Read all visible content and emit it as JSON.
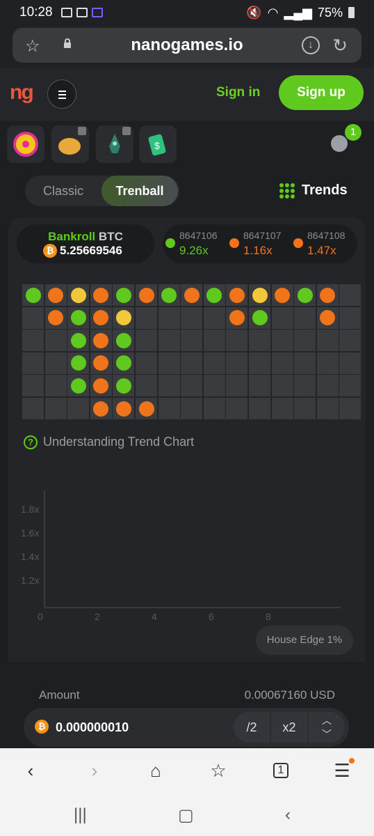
{
  "status": {
    "time": "10:28",
    "battery": "75%"
  },
  "browser": {
    "url": "nanogames.io",
    "tab_count": "1"
  },
  "header": {
    "logo": "ng",
    "signin_label": "Sign in",
    "signup_label": "Sign up"
  },
  "games_strip": {
    "chat_badge": "1"
  },
  "modes": {
    "classic_label": "Classic",
    "trenball_label": "Trenball",
    "active": "Trenball"
  },
  "trends_label": "Trends",
  "bankroll": {
    "label_green": "Bankroll",
    "label_currency": "BTC",
    "value": "5.25669546",
    "icon": "₿"
  },
  "history": [
    {
      "id": "8647106",
      "multiplier": "9.26x",
      "color": "#5fc91e"
    },
    {
      "id": "8647107",
      "multiplier": "1.16x",
      "color": "#f2741a"
    },
    {
      "id": "8647108",
      "multiplier": "1.47x",
      "color": "#f2741a"
    }
  ],
  "trend_grid": {
    "colors": {
      "g": "#5fc91e",
      "o": "#f2741a",
      "y": "#f2c83a"
    },
    "columns": [
      [
        "g",
        "",
        "",
        "",
        "",
        ""
      ],
      [
        "o",
        "o",
        "",
        "",
        "",
        ""
      ],
      [
        "y",
        "g",
        "g",
        "g",
        "g",
        ""
      ],
      [
        "o",
        "o",
        "o",
        "o",
        "o",
        "o"
      ],
      [
        "g",
        "y",
        "g",
        "g",
        "g",
        "o"
      ],
      [
        "o",
        "",
        "",
        "",
        "",
        "o"
      ],
      [
        "g",
        "",
        "",
        "",
        "",
        ""
      ],
      [
        "o",
        "",
        "",
        "",
        "",
        ""
      ],
      [
        "g",
        "",
        "",
        "",
        "",
        ""
      ],
      [
        "o",
        "o",
        "",
        "",
        "",
        ""
      ],
      [
        "y",
        "g",
        "",
        "",
        "",
        ""
      ],
      [
        "o",
        "",
        "",
        "",
        "",
        ""
      ],
      [
        "g",
        "",
        "",
        "",
        "",
        ""
      ],
      [
        "o",
        "o",
        "",
        "",
        "",
        ""
      ],
      [
        "",
        "",
        "",
        "",
        "",
        ""
      ]
    ]
  },
  "understanding_label": "Understanding Trend Chart",
  "chart": {
    "y_ticks": [
      "1.8x",
      "1.6x",
      "1.4x",
      "1.2x"
    ],
    "x_ticks": [
      "0",
      "2",
      "4",
      "6",
      "8"
    ]
  },
  "house_edge": "House Edge 1%",
  "amount": {
    "label": "Amount",
    "usd": "0.00067160 USD",
    "value": "0.000000010",
    "half_label": "/2",
    "double_label": "x2"
  },
  "bottom_nav": {
    "tabs_count": "1"
  }
}
